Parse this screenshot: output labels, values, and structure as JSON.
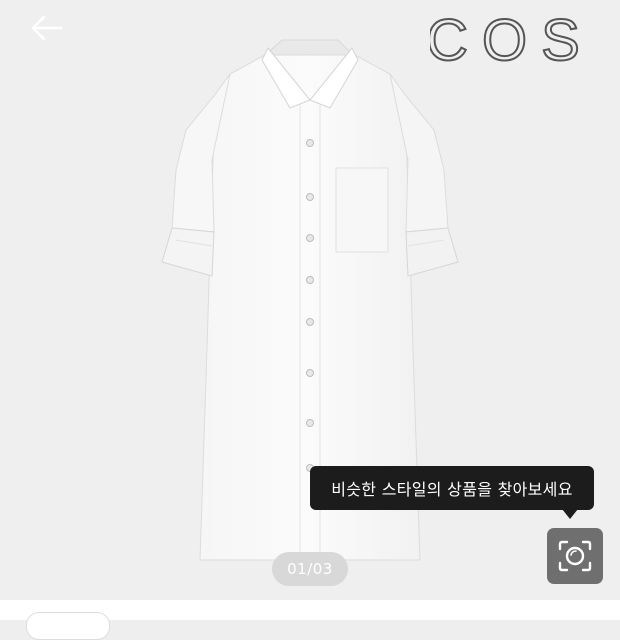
{
  "header": {
    "back_icon": "arrow-left-icon",
    "brand": "COS"
  },
  "product_image": {
    "description_icon": "white-shirt-dress-image"
  },
  "tooltip": {
    "text": "비슷한 스타일의 상품을 찾아보세요"
  },
  "lens_button": {
    "icon": "camera-lens-icon"
  },
  "pager": {
    "current": "01",
    "total": "03",
    "label": "01/03"
  },
  "colors": {
    "background": "#efefef",
    "tooltip": "#1c1c1c",
    "lens_button": "#6f6f6f",
    "pager": "#d8d8d8"
  }
}
